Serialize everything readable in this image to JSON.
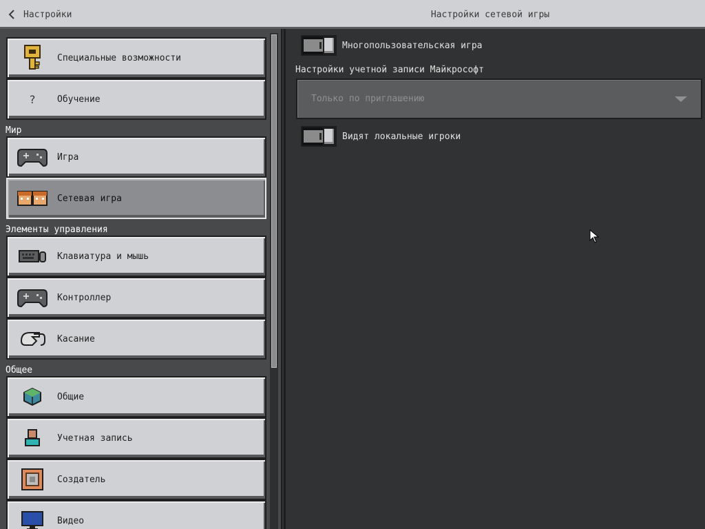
{
  "header": {
    "back_label": "Настройки",
    "title": "Настройки сетевой игры"
  },
  "sidebar": {
    "sections": {
      "world": "Мир",
      "controls": "Элементы управления",
      "general": "Общее"
    },
    "items": [
      {
        "label": "Специальные возможности",
        "icon": "key-icon"
      },
      {
        "label": "Обучение",
        "icon": "question-icon"
      },
      {
        "label": "Игра",
        "icon": "gamepad-icon"
      },
      {
        "label": "Сетевая игра",
        "icon": "players-icon",
        "selected": true
      },
      {
        "label": "Клавиатура и мышь",
        "icon": "keyboard-mouse-icon"
      },
      {
        "label": "Контроллер",
        "icon": "controller-icon"
      },
      {
        "label": "Касание",
        "icon": "touch-icon"
      },
      {
        "label": "Общие",
        "icon": "globe-icon"
      },
      {
        "label": "Учетная запись",
        "icon": "account-icon"
      },
      {
        "label": "Создатель",
        "icon": "creator-icon"
      },
      {
        "label": "Видео",
        "icon": "monitor-icon"
      }
    ]
  },
  "main": {
    "multiplayer_toggle": {
      "label": "Многопользовательская игра",
      "on": false
    },
    "account_settings_label": "Настройки учетной записи Майкрософт",
    "account_dropdown": {
      "value": "Только по приглашению"
    },
    "local_players_toggle": {
      "label": "Видят локальные игроки",
      "on": false
    }
  },
  "colors": {
    "header_bg": "#d0d1d4",
    "main_bg": "#313233",
    "item_bg": "#d0d1d4",
    "selected_item_bg": "#8c8d90"
  }
}
